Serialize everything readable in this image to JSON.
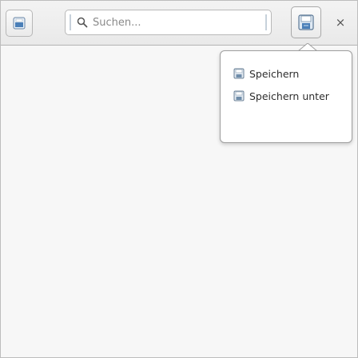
{
  "headerbar": {
    "app_icon": "document-icon",
    "search": {
      "placeholder": "Suchen...",
      "icon": "search-icon"
    },
    "menu_button_icon": "document-save-icon",
    "close_label": "×"
  },
  "popover_menu": {
    "items": [
      {
        "label": "Speichern",
        "icon": "save-icon"
      },
      {
        "label": "Speichern unter",
        "icon": "save-as-icon"
      }
    ]
  },
  "colors": {
    "accent": "#4a90d9",
    "headerbar_bg": "#ededed",
    "popover_border": "#9e9e9e"
  }
}
